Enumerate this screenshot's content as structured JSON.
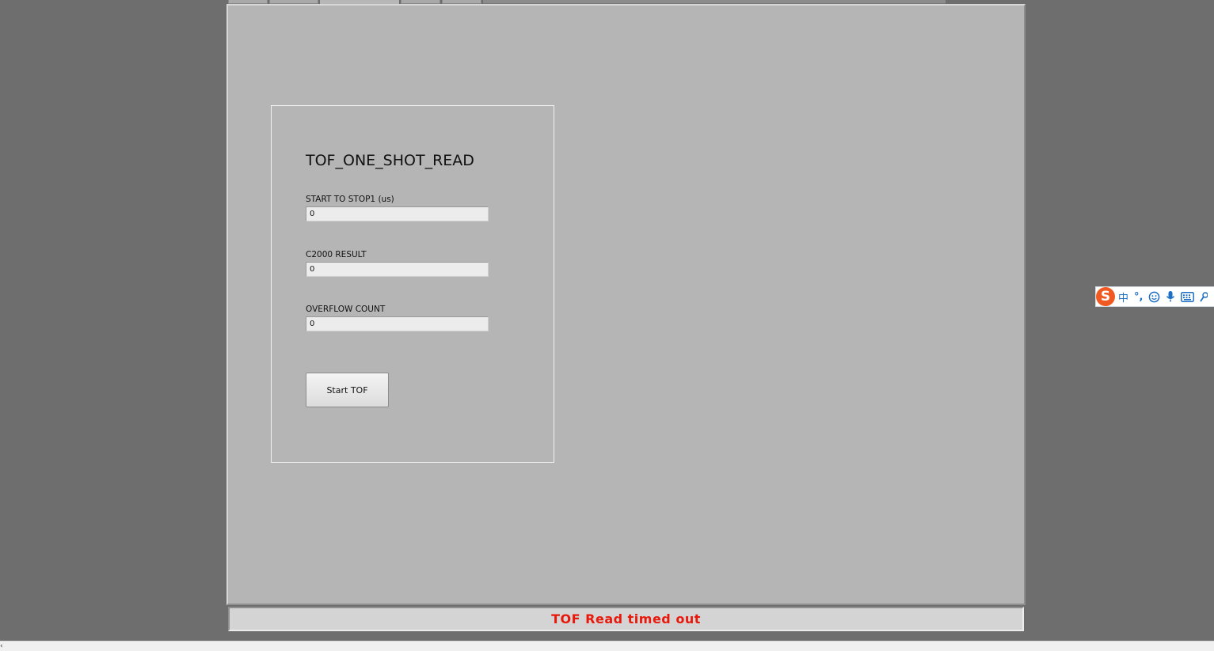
{
  "panel": {
    "title": "TOF_ONE_SHOT_READ",
    "fields": [
      {
        "label": "START TO STOP1 (us)",
        "value": "0"
      },
      {
        "label": "C2000 RESULT",
        "value": "0"
      },
      {
        "label": "OVERFLOW COUNT",
        "value": "0"
      }
    ],
    "start_button_label": "Start TOF"
  },
  "status": {
    "message": "TOF Read timed out",
    "color": "#e8190c"
  },
  "ime_toolbar": {
    "logo": "S",
    "mode": "中",
    "punctuation": "°,",
    "icons": [
      "emoji-icon",
      "microphone-icon",
      "keyboard-icon",
      "settings-icon"
    ]
  },
  "bottom_bar": {
    "arrow": "‹"
  }
}
